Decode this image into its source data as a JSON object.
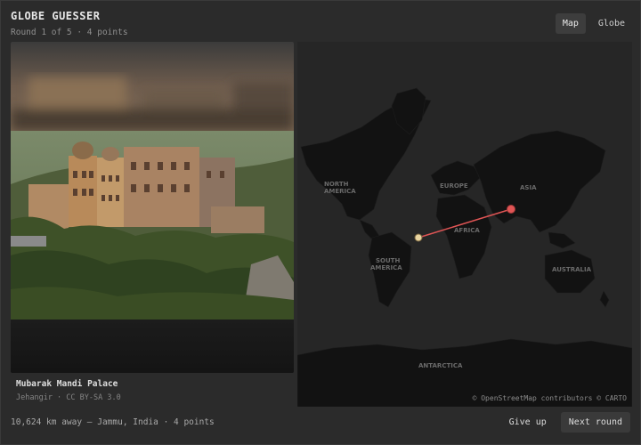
{
  "header": {
    "title": "GLOBE GUESSER",
    "subtitle": "Round 1 of 5 · 4 points"
  },
  "view_toggle": {
    "map_label": "Map",
    "globe_label": "Globe",
    "active": "Map"
  },
  "photo": {
    "caption_title": "Mubarak Mandi Palace",
    "caption_credit": "Jehangir · CC BY-SA 3.0"
  },
  "map": {
    "labels": {
      "north_america": [
        "NORTH",
        "AMERICA"
      ],
      "south_america": [
        "SOUTH",
        "AMERICA"
      ],
      "europe": "EUROPE",
      "asia": "ASIA",
      "africa": "AFRICA",
      "australia": "AUSTRALIA",
      "antarctica": "ANTARCTICA"
    },
    "attribution": "© OpenStreetMap contributors © CARTO",
    "guess_color": "#e8d4a0",
    "answer_color": "#e05555"
  },
  "footer": {
    "result": "10,624 km away — Jammu, India · 4 points"
  },
  "actions": {
    "give_up": "Give up",
    "next_round": "Next round"
  }
}
